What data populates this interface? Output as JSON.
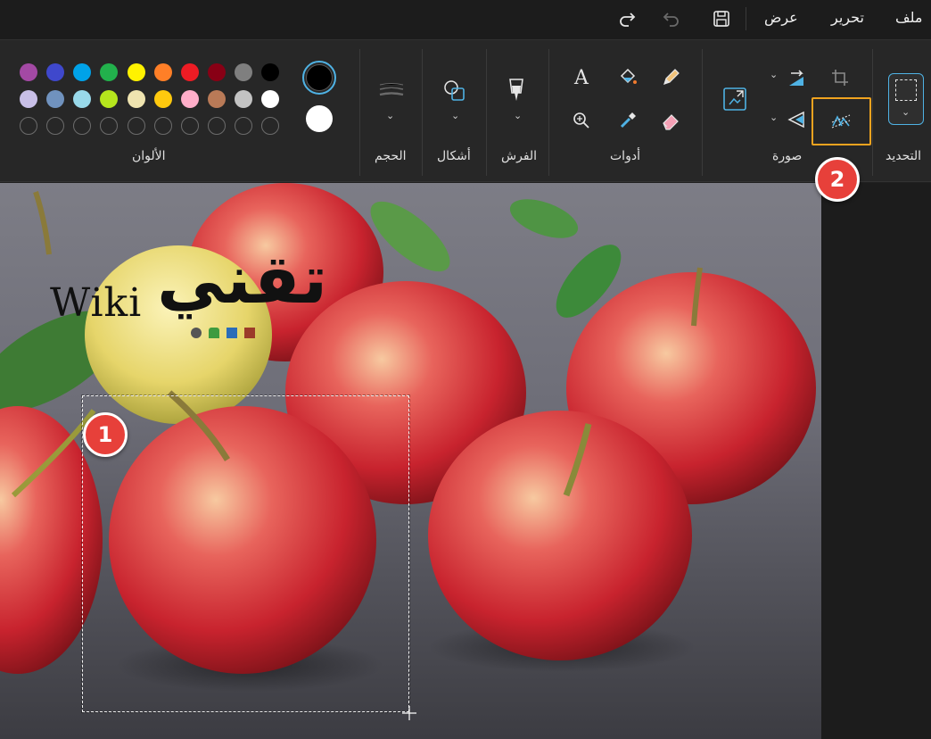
{
  "menu": {
    "file": "ملف",
    "edit": "تحرير",
    "view": "عرض"
  },
  "quick_access": {
    "save_icon": "save-icon",
    "undo_icon": "undo-icon",
    "redo_icon": "redo-icon"
  },
  "ribbon": {
    "groups": {
      "selection": "التحديد",
      "image": "صورة",
      "tools": "أدوات",
      "brushes": "الفرش",
      "shapes": "أشكال",
      "size": "الحجم",
      "colors": "الألوان"
    },
    "colors": {
      "primary": "#000000",
      "secondary": "#ffffff",
      "row1": [
        "#000000",
        "#7f7f7f",
        "#880015",
        "#ed1c24",
        "#ff7f27",
        "#fff200",
        "#22b14c",
        "#00a2e8",
        "#3f48cc",
        "#a349a4"
      ],
      "row2": [
        "#ffffff",
        "#c3c3c3",
        "#b97a57",
        "#ffaec9",
        "#ffc90e",
        "#efe4b0",
        "#b5e61d",
        "#99d9ea",
        "#7092be",
        "#c8bfe7"
      ],
      "accent": "#4fb2e4",
      "highlight": "#f0a31f"
    }
  },
  "canvas": {
    "logo_latin": "Wiki",
    "logo_arabic": "تقني"
  },
  "annotations": {
    "badge1": "1",
    "badge2": "2",
    "badge_color": "#e7403a"
  }
}
